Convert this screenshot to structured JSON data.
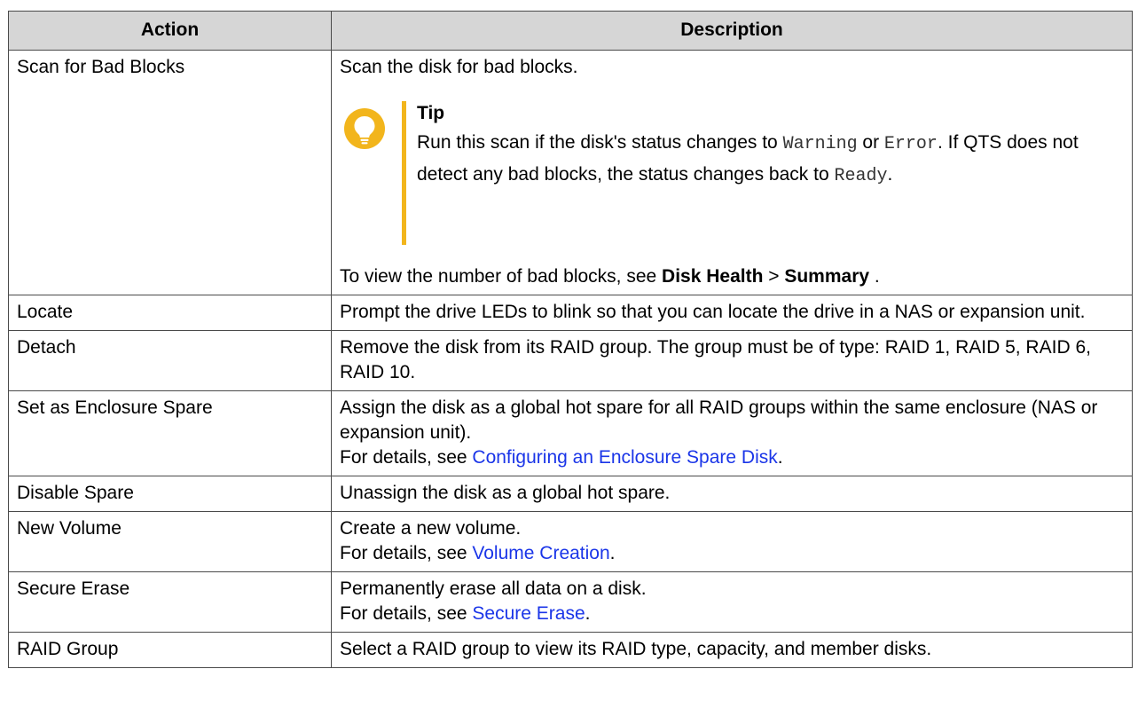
{
  "table": {
    "headers": {
      "action": "Action",
      "description": "Description"
    },
    "rows": {
      "scan": {
        "action": "Scan for Bad Blocks",
        "text": "Scan the disk for bad blocks.",
        "tip": {
          "title": "Tip",
          "body_1": "Run this scan if the disk's status changes to ",
          "code_warning": "Warning",
          "body_2": " or ",
          "code_error": "Error",
          "body_3": ". If QTS does not detect any bad blocks, the status changes back to ",
          "code_ready": "Ready",
          "body_4": "."
        },
        "view_prefix": "To view the number of bad blocks, see ",
        "view_bold_1": "Disk Health",
        "view_sep": " > ",
        "view_bold_2": "Summary",
        "view_suffix": " ."
      },
      "locate": {
        "action": "Locate",
        "text": "Prompt the drive LEDs to blink so that you can locate the drive in a NAS or expansion unit."
      },
      "detach": {
        "action": "Detach",
        "text": "Remove the disk from its RAID group. The group must be of type: RAID 1, RAID 5, RAID 6, RAID 10."
      },
      "enclosure_spare": {
        "action": "Set as Enclosure Spare",
        "text": "Assign the disk as a global hot spare for all RAID groups within the same enclosure (NAS or expansion unit).",
        "details_prefix": "For details, see ",
        "link": "Configuring an Enclosure Spare Disk",
        "details_suffix": "."
      },
      "disable_spare": {
        "action": "Disable Spare",
        "text": "Unassign the disk as a global hot spare."
      },
      "new_volume": {
        "action": "New Volume",
        "text": "Create a new volume.",
        "details_prefix": "For details, see ",
        "link": "Volume Creation",
        "details_suffix": "."
      },
      "secure_erase": {
        "action": "Secure Erase",
        "text": "Permanently erase all data on a disk.",
        "details_prefix": "For details, see ",
        "link": "Secure Erase",
        "details_suffix": "."
      },
      "raid_group": {
        "action": "RAID Group",
        "text": "Select a RAID group to view its RAID type, capacity, and member disks."
      }
    }
  },
  "icons": {
    "tip": "lightbulb-icon"
  },
  "colors": {
    "header_bg": "#d6d6d6",
    "border": "#4a4a4a",
    "link": "#1a35e8",
    "tip_accent": "#f2b51c"
  }
}
